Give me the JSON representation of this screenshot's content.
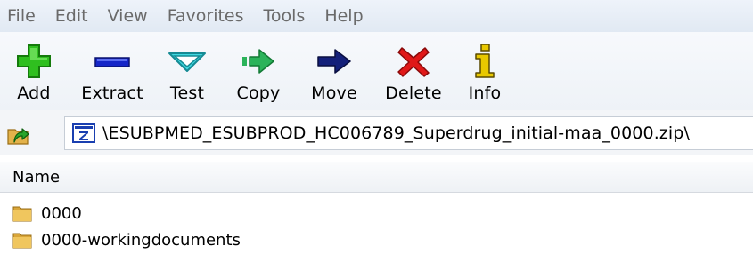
{
  "menubar": {
    "items": [
      "File",
      "Edit",
      "View",
      "Favorites",
      "Tools",
      "Help"
    ]
  },
  "toolbar": {
    "buttons": [
      {
        "label": "Add",
        "icon": "add-icon",
        "color": "#2fbf1f"
      },
      {
        "label": "Extract",
        "icon": "extract-icon",
        "color": "#1626c8"
      },
      {
        "label": "Test",
        "icon": "test-icon",
        "color": "#3fd8e0"
      },
      {
        "label": "Copy",
        "icon": "copy-icon",
        "color": "#2bb35a"
      },
      {
        "label": "Move",
        "icon": "move-icon",
        "color": "#14207a"
      },
      {
        "label": "Delete",
        "icon": "delete-icon",
        "color": "#e01818"
      },
      {
        "label": "Info",
        "icon": "info-icon",
        "color": "#e8c800"
      }
    ]
  },
  "address": {
    "path": "\\ESUBPMED_ESUBPROD_HC006789_Superdrug_initial-maa_0000.zip\\"
  },
  "list": {
    "columns": [
      "Name"
    ],
    "rows": [
      {
        "name": "0000"
      },
      {
        "name": "0000-workingdocuments"
      }
    ]
  }
}
